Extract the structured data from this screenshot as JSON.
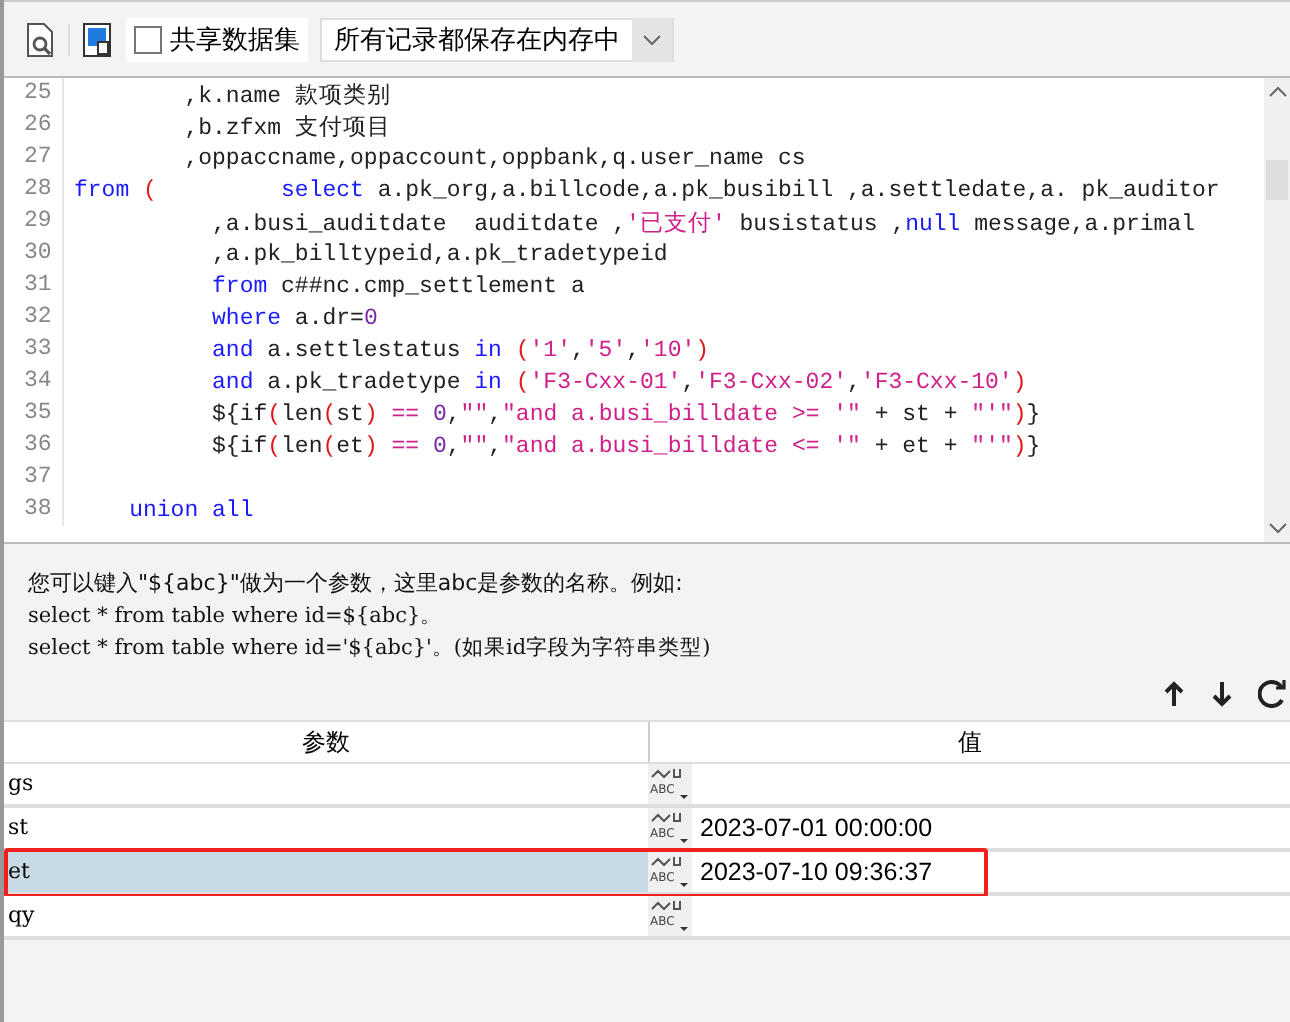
{
  "toolbar": {
    "share_checkbox": {
      "label": "共享数据集",
      "checked": false
    },
    "storage_select": {
      "value": "所有记录都保存在内存中"
    }
  },
  "editor": {
    "lines": [
      {
        "number": "25",
        "tokens": [
          {
            "kind": "plain",
            "text": "        ,k.name 款项类别"
          }
        ]
      },
      {
        "number": "26",
        "tokens": [
          {
            "kind": "plain",
            "text": "        ,b.zfxm 支付项目"
          }
        ]
      },
      {
        "number": "27",
        "tokens": [
          {
            "kind": "plain",
            "text": "        ,oppaccname,oppaccount,oppbank,q.user_name cs"
          }
        ]
      },
      {
        "number": "28",
        "tokens": [
          {
            "kind": "keyword",
            "text": "from"
          },
          {
            "kind": "paren",
            "text": " ("
          },
          {
            "kind": "keyword",
            "text": "         select"
          },
          {
            "kind": "plain",
            "text": " a.pk_org,a.billcode,a.pk_busibill ,a.settledate,a. pk_auditor"
          }
        ]
      },
      {
        "number": "29",
        "tokens": [
          {
            "kind": "plain",
            "text": "          ,a.busi_auditdate  auditdate ,"
          },
          {
            "kind": "string",
            "text": "'已支付'"
          },
          {
            "kind": "plain",
            "text": " busistatus ,"
          },
          {
            "kind": "keyword",
            "text": "null"
          },
          {
            "kind": "plain",
            "text": " message,a.primal"
          }
        ]
      },
      {
        "number": "30",
        "tokens": [
          {
            "kind": "plain",
            "text": "          ,a.pk_billtypeid,a.pk_tradetypeid"
          }
        ]
      },
      {
        "number": "31",
        "tokens": [
          {
            "kind": "keyword",
            "text": "          from"
          },
          {
            "kind": "plain",
            "text": " c##nc.cmp_settlement a"
          }
        ]
      },
      {
        "number": "32",
        "tokens": [
          {
            "kind": "keyword",
            "text": "          where"
          },
          {
            "kind": "plain",
            "text": " a.dr="
          },
          {
            "kind": "number",
            "text": "0"
          }
        ]
      },
      {
        "number": "33",
        "tokens": [
          {
            "kind": "keyword",
            "text": "          and"
          },
          {
            "kind": "plain",
            "text": " a.settlestatus "
          },
          {
            "kind": "keyword",
            "text": "in"
          },
          {
            "kind": "paren",
            "text": " ("
          },
          {
            "kind": "string",
            "text": "'1'"
          },
          {
            "kind": "plain",
            "text": ","
          },
          {
            "kind": "string",
            "text": "'5'"
          },
          {
            "kind": "plain",
            "text": ","
          },
          {
            "kind": "string",
            "text": "'10'"
          },
          {
            "kind": "paren",
            "text": ")"
          }
        ]
      },
      {
        "number": "34",
        "tokens": [
          {
            "kind": "keyword",
            "text": "          and"
          },
          {
            "kind": "plain",
            "text": " a.pk_tradetype "
          },
          {
            "kind": "keyword",
            "text": "in"
          },
          {
            "kind": "paren",
            "text": " ("
          },
          {
            "kind": "string",
            "text": "'F3-Cxx-01'"
          },
          {
            "kind": "plain",
            "text": ","
          },
          {
            "kind": "string",
            "text": "'F3-Cxx-02'"
          },
          {
            "kind": "plain",
            "text": ","
          },
          {
            "kind": "string",
            "text": "'F3-Cxx-10'"
          },
          {
            "kind": "paren",
            "text": ")"
          }
        ]
      },
      {
        "number": "35",
        "tokens": [
          {
            "kind": "plain",
            "text": "          ${if"
          },
          {
            "kind": "paren",
            "text": "("
          },
          {
            "kind": "plain",
            "text": "len"
          },
          {
            "kind": "paren",
            "text": "("
          },
          {
            "kind": "plain",
            "text": "st"
          },
          {
            "kind": "paren",
            "text": ")"
          },
          {
            "kind": "string",
            "text": " == "
          },
          {
            "kind": "number",
            "text": "0"
          },
          {
            "kind": "plain",
            "text": ","
          },
          {
            "kind": "string",
            "text": "\"\""
          },
          {
            "kind": "plain",
            "text": ","
          },
          {
            "kind": "string",
            "text": "\"and a.busi_billdate >= '\""
          },
          {
            "kind": "plain",
            "text": " + st + "
          },
          {
            "kind": "string",
            "text": "\"'\""
          },
          {
            "kind": "paren",
            "text": ")"
          },
          {
            "kind": "plain",
            "text": "}"
          }
        ]
      },
      {
        "number": "36",
        "tokens": [
          {
            "kind": "plain",
            "text": "          ${if"
          },
          {
            "kind": "paren",
            "text": "("
          },
          {
            "kind": "plain",
            "text": "len"
          },
          {
            "kind": "paren",
            "text": "("
          },
          {
            "kind": "plain",
            "text": "et"
          },
          {
            "kind": "paren",
            "text": ")"
          },
          {
            "kind": "string",
            "text": " == "
          },
          {
            "kind": "number",
            "text": "0"
          },
          {
            "kind": "plain",
            "text": ","
          },
          {
            "kind": "string",
            "text": "\"\""
          },
          {
            "kind": "plain",
            "text": ","
          },
          {
            "kind": "string",
            "text": "\"and a.busi_billdate <= '\""
          },
          {
            "kind": "plain",
            "text": " + et + "
          },
          {
            "kind": "string",
            "text": "\"'\""
          },
          {
            "kind": "paren",
            "text": ")"
          },
          {
            "kind": "plain",
            "text": "}"
          }
        ]
      },
      {
        "number": "37"
      },
      {
        "number": "38",
        "tokens": [
          {
            "kind": "keyword",
            "text": "    union all"
          }
        ]
      }
    ]
  },
  "hint": {
    "lines": [
      "您可以键入\"${abc}\"做为一个参数，这里abc是参数的名称。例如:",
      "select * from table where id=${abc}。",
      "select * from table where id='${abc}'。(如果id字段为字符串类型)"
    ]
  },
  "params_table": {
    "columns": [
      "参数",
      "值"
    ],
    "rows": [
      {
        "name": "gs",
        "type_label": "ABC",
        "selected": false
      },
      {
        "name": "st",
        "type_label": "ABC",
        "value": "2023-07-01 00:00:00",
        "selected": false
      },
      {
        "name": "et",
        "type_label": "ABC",
        "value": "2023-07-10 09:36:37",
        "selected": true
      },
      {
        "name": "qy",
        "type_label": "ABC",
        "selected": false
      }
    ]
  }
}
